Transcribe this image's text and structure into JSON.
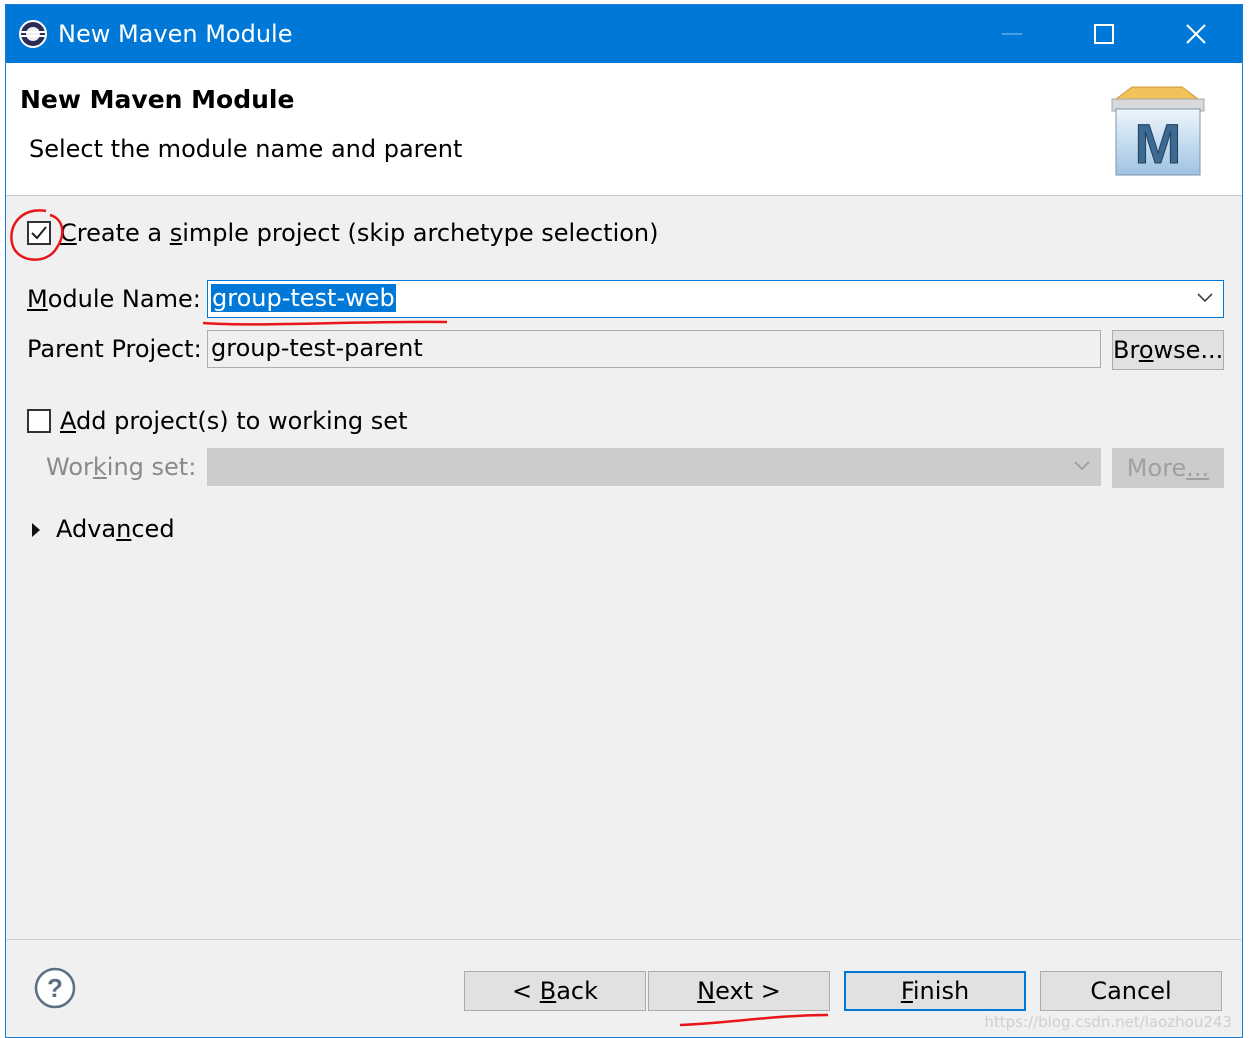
{
  "window": {
    "title": "New Maven Module",
    "app_icon": "eclipse-icon",
    "controls": [
      "minimize-icon",
      "maximize-icon",
      "close-icon"
    ]
  },
  "header": {
    "title": "New Maven Module",
    "description": "Select the module name and parent",
    "logo_icon": "maven-icon",
    "logo_letter": "M"
  },
  "simple_project": {
    "label_prefix": "",
    "label_u": "C",
    "label_mid": "reate a ",
    "label_u2": "s",
    "label_rest": "imple project (skip archetype selection)",
    "checked": true
  },
  "module_name": {
    "label_u": "M",
    "label_rest": "odule Name:",
    "value": "group-test-web"
  },
  "parent_project": {
    "label": "Parent Project:",
    "value": "group-test-parent",
    "browse_pre": "Br",
    "browse_u": "o",
    "browse_post": "wse..."
  },
  "working_set_toggle": {
    "label_u": "A",
    "label_rest": "dd project(s) to working set",
    "checked": false
  },
  "working_set": {
    "label_pre": "Wor",
    "label_u": "k",
    "label_post": "ing set:",
    "value": "",
    "more_pre": "More",
    "more_u": "...",
    "more_post": ""
  },
  "advanced": {
    "label_pre": "Adva",
    "label_u": "n",
    "label_post": "ced"
  },
  "footer": {
    "help_icon": "help-icon",
    "back_pre": "< ",
    "back_u": "B",
    "back_post": "ack",
    "next_u": "N",
    "next_post": "ext >",
    "finish_u": "F",
    "finish_post": "inish",
    "cancel": "Cancel"
  },
  "watermark": "https://blog.csdn.net/laozhou243",
  "colors": {
    "titlebar": "#0078d7",
    "selection": "#0078d7",
    "annotation": "#e8151b"
  }
}
